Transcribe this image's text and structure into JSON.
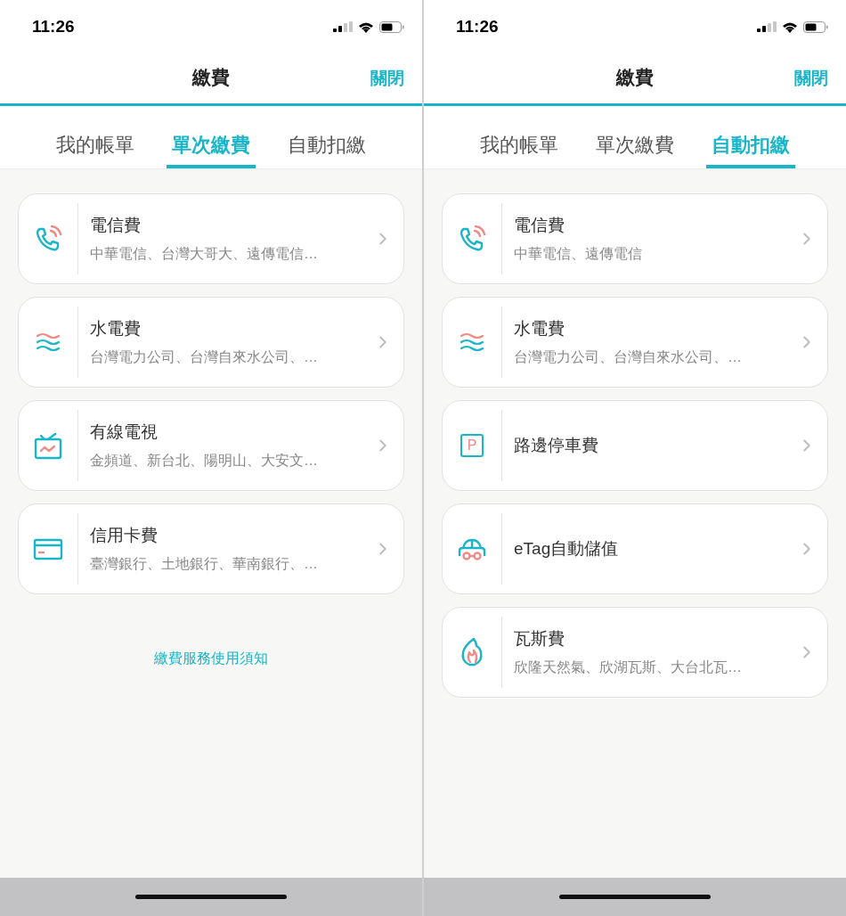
{
  "screens": [
    {
      "status_bar": {
        "time": "11:26"
      },
      "header": {
        "title": "繳費",
        "close": "關閉"
      },
      "tabs": [
        {
          "label": "我的帳單",
          "selected": false
        },
        {
          "label": "單次繳費",
          "selected": true
        },
        {
          "label": "自動扣繳",
          "selected": false
        }
      ],
      "items": [
        {
          "kind": "phone",
          "title": "電信費",
          "subtitle": "中華電信、台灣大哥大、遠傳電信…"
        },
        {
          "kind": "waves",
          "title": "水電費",
          "subtitle": "台灣電力公司、台灣自來水公司、…"
        },
        {
          "kind": "tv",
          "title": "有線電視",
          "subtitle": "金頻道、新台北、陽明山、大安文…"
        },
        {
          "kind": "card",
          "title": "信用卡費",
          "subtitle": "臺灣銀行、土地銀行、華南銀行、…"
        }
      ],
      "footer_link": "繳費服務使用須知"
    },
    {
      "status_bar": {
        "time": "11:26"
      },
      "header": {
        "title": "繳費",
        "close": "關閉"
      },
      "tabs": [
        {
          "label": "我的帳單",
          "selected": false
        },
        {
          "label": "單次繳費",
          "selected": false
        },
        {
          "label": "自動扣繳",
          "selected": true
        }
      ],
      "items": [
        {
          "kind": "phone",
          "title": "電信費",
          "subtitle": "中華電信、遠傳電信"
        },
        {
          "kind": "waves",
          "title": "水電費",
          "subtitle": "台灣電力公司、台灣自來水公司、…"
        },
        {
          "kind": "parking",
          "badge": "P",
          "title": "路邊停車費"
        },
        {
          "kind": "car",
          "title": "eTag自動儲值"
        },
        {
          "kind": "flame",
          "title": "瓦斯費",
          "subtitle": "欣隆天然氣、欣湖瓦斯、大台北瓦…"
        }
      ]
    }
  ]
}
